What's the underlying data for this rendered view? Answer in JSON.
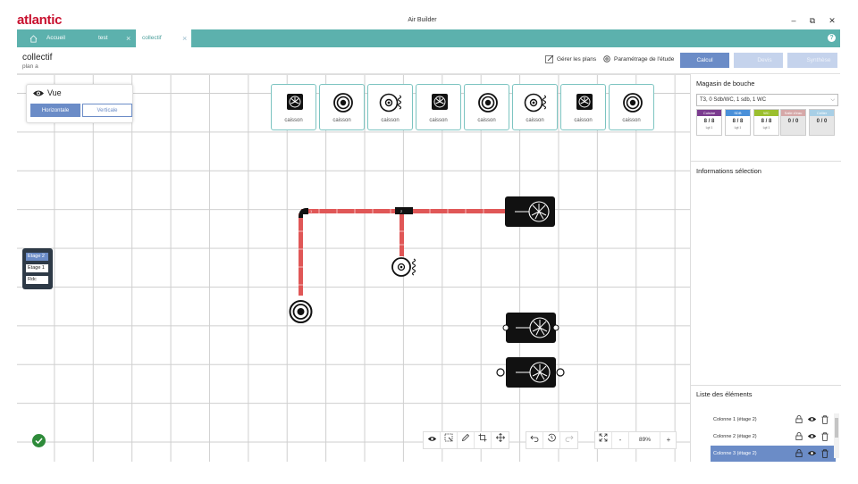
{
  "app": {
    "brand": "atlantic",
    "window_title": "Air Builder"
  },
  "window_controls": {
    "minimize": "–",
    "restore": "⧉",
    "close": "✕"
  },
  "tabs": [
    {
      "label": "Accueil",
      "icon": "home-icon"
    },
    {
      "label": "test",
      "close": "×"
    },
    {
      "label": "collectif",
      "close": "×"
    }
  ],
  "header": {
    "title": "collectif",
    "subtitle": "plan a",
    "manage_plans": "Gérer les plans",
    "study_settings": "Paramétrage de l'étude",
    "calc": "Calcul",
    "quote": "Devis",
    "summary": "Synthèse"
  },
  "view_panel": {
    "title": "Vue",
    "horizontal": "Horizontale",
    "vertical": "Verticale"
  },
  "caissons": [
    {
      "label": "caisson",
      "icon": "fan-square-icon"
    },
    {
      "label": "caisson",
      "icon": "vent-round-icon"
    },
    {
      "label": "caisson",
      "icon": "vent-coil-icon"
    },
    {
      "label": "caisson",
      "icon": "fan-square-icon"
    },
    {
      "label": "caisson",
      "icon": "vent-round-icon"
    },
    {
      "label": "caisson",
      "icon": "vent-coil-icon"
    },
    {
      "label": "caisson",
      "icon": "fan-square-icon"
    },
    {
      "label": "caisson",
      "icon": "vent-round-icon"
    }
  ],
  "floors": [
    {
      "label": "Etage 2",
      "selected": true
    },
    {
      "label": "Etage 1",
      "selected": false
    },
    {
      "label": "Rdc",
      "selected": false
    }
  ],
  "toolbar": {
    "zoom": "89%",
    "zoom_out": "-",
    "zoom_in": "+"
  },
  "right_panel": {
    "store_title": "Magasin de bouche",
    "select_value": "T3, 0 Sdb/WC, 1 sdb, 1 WC",
    "cards": [
      {
        "head": "Cuisine",
        "value": "8 / 8",
        "sub": "Lgt 1",
        "color": "#7b3c8f"
      },
      {
        "head": "SDB",
        "value": "8 / 8",
        "sub": "Lgt 1",
        "color": "#4a90d9"
      },
      {
        "head": "WC",
        "value": "8 / 8",
        "sub": "Lgt 1",
        "color": "#9bbf2e"
      },
      {
        "head": "Salle d'eau",
        "value": "0 / 0",
        "sub": "",
        "color": "#d6a8a8"
      },
      {
        "head": "Cellier",
        "value": "0 / 0",
        "sub": "",
        "color": "#a8cfe6"
      }
    ],
    "selection_title": "Informations sélection",
    "elements_title": "Liste des éléments",
    "elements": [
      {
        "label": "Colonne 1 (étage 2)",
        "selected": false
      },
      {
        "label": "Colonne 2 (étage 2)",
        "selected": false
      },
      {
        "label": "Colonne 3 (étage 2)",
        "selected": true
      }
    ]
  },
  "colors": {
    "accent": "#5cb1ad",
    "primary": "#6b8cc7",
    "duct": "#e05757",
    "brand": "#c8102e"
  }
}
